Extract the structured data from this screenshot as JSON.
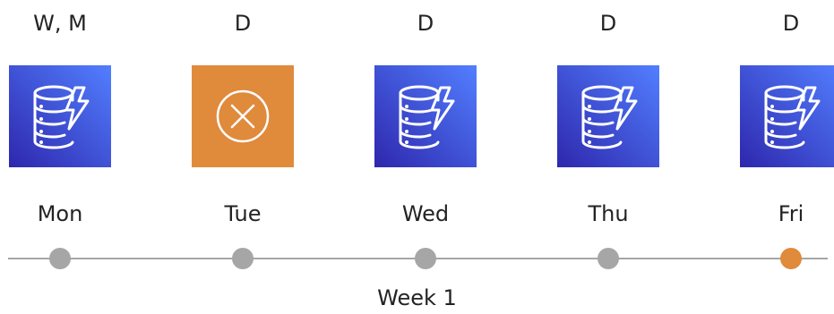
{
  "colors": {
    "ok_tile_gradient": [
      "#2e27ad",
      "#527fff"
    ],
    "fail_tile": "#e08a3c",
    "dot_default": "#a6a6a6",
    "dot_highlight": "#e08a3c",
    "axis": "#a6a6a6"
  },
  "days": [
    {
      "label": "Mon",
      "tag": "W, M",
      "icon": "database-lightning-icon",
      "status": "ok",
      "dot": "default"
    },
    {
      "label": "Tue",
      "tag": "D",
      "icon": "circle-x-icon",
      "status": "failed",
      "dot": "default"
    },
    {
      "label": "Wed",
      "tag": "D",
      "icon": "database-lightning-icon",
      "status": "ok",
      "dot": "default"
    },
    {
      "label": "Thu",
      "tag": "D",
      "icon": "database-lightning-icon",
      "status": "ok",
      "dot": "default"
    },
    {
      "label": "Fri",
      "tag": "D",
      "icon": "database-lightning-icon",
      "status": "ok",
      "dot": "highlight"
    }
  ],
  "timeline": {
    "label": "Week 1"
  }
}
